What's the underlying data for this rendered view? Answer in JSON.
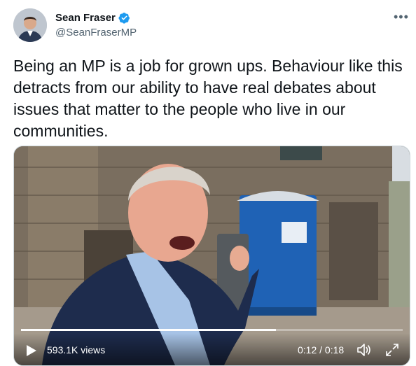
{
  "author": {
    "name": "Sean Fraser",
    "handle": "@SeanFraserMP",
    "verified": true
  },
  "tweet": {
    "text": "Being an MP is a job for grown ups. Behaviour like this detracts from our ability to have real debates about issues that matter to the people who live in our communities."
  },
  "video": {
    "views": "593.1K views",
    "time": "0:12 / 0:18",
    "progress_fraction": 0.667
  },
  "icons": {
    "more": "more-icon",
    "verified": "verified-badge-icon",
    "play": "play-icon",
    "volume": "volume-icon",
    "fullscreen": "fullscreen-icon"
  },
  "colors": {
    "verified": "#1d9bf0",
    "handle": "#536471",
    "text": "#0f1419"
  }
}
